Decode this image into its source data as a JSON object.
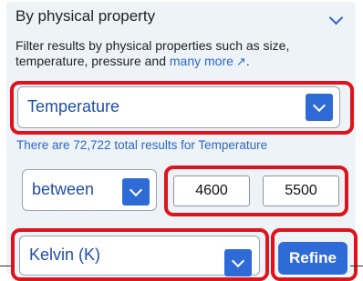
{
  "section": {
    "title": "By physical property",
    "description": "Filter results by physical properties such as size, temperature, pressure and ",
    "more_link": "many more",
    "more_suffix": "."
  },
  "property_select": {
    "value": "Temperature"
  },
  "results_text": "There are 72,722 total results for Temperature",
  "range": {
    "operator": "between",
    "min": "4600",
    "max": "5500"
  },
  "unit_select": {
    "value": "Kelvin (K)"
  },
  "refine_button": "Refine",
  "colors": {
    "accent": "#2f6bd6",
    "highlight": "#e0121c",
    "panel_bg": "#eef3f8"
  },
  "icons": {
    "header_toggle": "chevron-down-icon",
    "external_link": "external-link-icon",
    "dropdown": "dropdown-arrow-icon"
  }
}
